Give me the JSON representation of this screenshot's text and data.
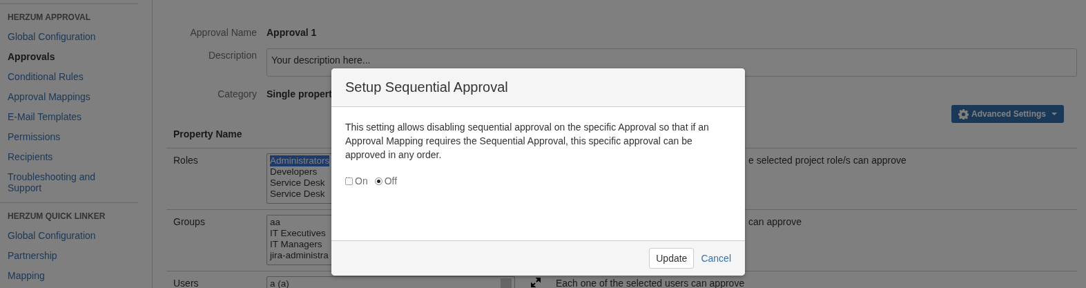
{
  "sidebar": {
    "sections": [
      {
        "heading": "HERZUM APPROVAL",
        "items": [
          {
            "label": "Global Configuration",
            "selected": false
          },
          {
            "label": "Approvals",
            "selected": true
          },
          {
            "label": "Conditional Rules",
            "selected": false
          },
          {
            "label": "Approval Mappings",
            "selected": false
          },
          {
            "label": "E-Mail Templates",
            "selected": false
          },
          {
            "label": "Permissions",
            "selected": false
          },
          {
            "label": "Recipients",
            "selected": false
          },
          {
            "label": "Troubleshooting and Support",
            "selected": false
          }
        ]
      },
      {
        "heading": "HERZUM QUICK LINKER",
        "items": [
          {
            "label": "Global Configuration",
            "selected": false
          },
          {
            "label": "Partnership",
            "selected": false
          },
          {
            "label": "Mapping",
            "selected": false
          }
        ]
      }
    ]
  },
  "form": {
    "fields": [
      {
        "kind": "text",
        "label": "Approval Name",
        "value": "Approval 1"
      },
      {
        "kind": "textarea",
        "label": "Description",
        "placeholder": "Your description here..."
      },
      {
        "kind": "text",
        "label": "Category",
        "value": "Single propert"
      }
    ]
  },
  "advanced_settings_button": "Advanced Settings",
  "table": {
    "columns": [
      "Property Name"
    ],
    "rows": [
      {
        "kind": "list",
        "name": "Roles",
        "covered": true,
        "options": [
          {
            "label": "Administrators",
            "selected": true
          },
          {
            "label": "Developers",
            "selected": false
          },
          {
            "label": "Service Desk",
            "selected": false
          },
          {
            "label": "Service Desk",
            "selected": false
          }
        ],
        "description": "e selected project role/s can approve"
      },
      {
        "kind": "list",
        "name": "Groups",
        "covered": true,
        "options": [
          {
            "label": "aa",
            "selected": false
          },
          {
            "label": "IT Executives",
            "selected": false
          },
          {
            "label": "IT Managers",
            "selected": false
          },
          {
            "label": "jira-administra",
            "selected": false
          }
        ],
        "description": "can approve"
      },
      {
        "kind": "picker",
        "name": "Users",
        "covered": false,
        "options": [
          {
            "label": "a (a)",
            "selected": false
          }
        ],
        "description": "Each one of the selected users can approve"
      }
    ]
  },
  "dialog": {
    "title": "Setup Sequential Approval",
    "message": "This setting allows disabling sequential approval on the specific Approval so that if an Approval Mapping requires the Sequential Approval, this specific approval can be approved in any order.",
    "options": [
      {
        "label": "On",
        "selected": false
      },
      {
        "label": "Off",
        "selected": true
      }
    ],
    "update_button": "Update",
    "cancel_link": "Cancel"
  }
}
